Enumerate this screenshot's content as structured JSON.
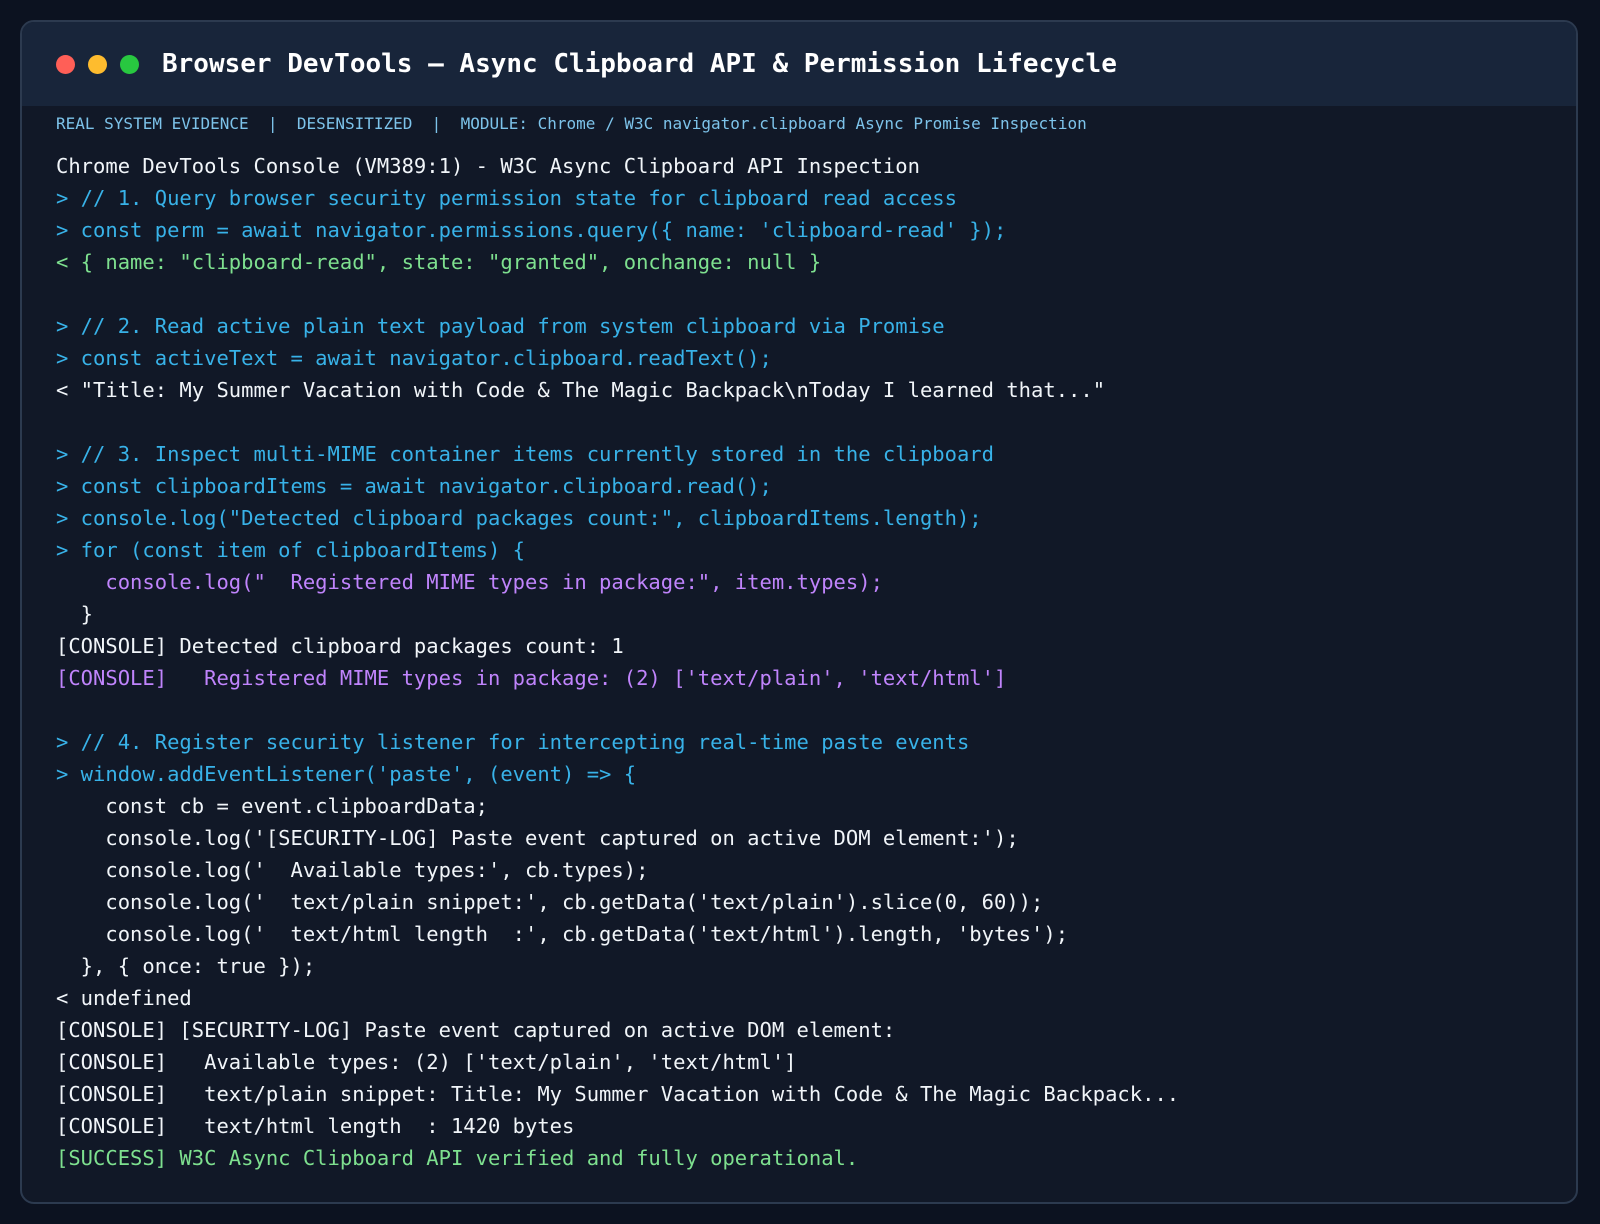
{
  "window": {
    "title": "Browser DevTools — Async Clipboard API & Permission Lifecycle",
    "controls": [
      {
        "name": "close-dot",
        "color": "#ff5f57"
      },
      {
        "name": "minimize-dot",
        "color": "#febc2e"
      },
      {
        "name": "maximize-dot",
        "color": "#28c840"
      }
    ]
  },
  "meta_banner": "REAL SYSTEM EVIDENCE  |  DESENSITIZED  |  MODULE: Chrome / W3C navigator.clipboard Async Promise Inspection",
  "console": {
    "lines": [
      {
        "kind": "header",
        "text": "Chrome DevTools Console (VM389:1) - W3C Async Clipboard API Inspection"
      },
      {
        "kind": "input",
        "text": "> // 1. Query browser security permission state for clipboard read access"
      },
      {
        "kind": "input",
        "text": "> const perm = await navigator.permissions.query({ name: 'clipboard-read' });"
      },
      {
        "kind": "result-obj",
        "text": "< { name: \"clipboard-read\", state: \"granted\", onchange: null }"
      },
      {
        "kind": "blank",
        "text": ""
      },
      {
        "kind": "input",
        "text": "> // 2. Read active plain text payload from system clipboard via Promise"
      },
      {
        "kind": "input",
        "text": "> const activeText = await navigator.clipboard.readText();"
      },
      {
        "kind": "plain",
        "text": "< \"Title: My Summer Vacation with Code & The Magic Backpack\\nToday I learned that...\""
      },
      {
        "kind": "blank",
        "text": ""
      },
      {
        "kind": "input",
        "text": "> // 3. Inspect multi-MIME container items currently stored in the clipboard"
      },
      {
        "kind": "input",
        "text": "> const clipboardItems = await navigator.clipboard.read();"
      },
      {
        "kind": "input",
        "text": "> console.log(\"Detected clipboard packages count:\", clipboardItems.length);"
      },
      {
        "kind": "input",
        "text": "> for (const item of clipboardItems) {"
      },
      {
        "kind": "purple",
        "text": "    console.log(\"  Registered MIME types in package:\", item.types);"
      },
      {
        "kind": "plain",
        "text": "  }"
      },
      {
        "kind": "plain",
        "text": "[CONSOLE] Detected clipboard packages count: 1"
      },
      {
        "kind": "purple",
        "text": "[CONSOLE]   Registered MIME types in package: (2) ['text/plain', 'text/html']"
      },
      {
        "kind": "blank",
        "text": ""
      },
      {
        "kind": "input",
        "text": "> // 4. Register security listener for intercepting real-time paste events"
      },
      {
        "kind": "input",
        "text": "> window.addEventListener('paste', (event) => {"
      },
      {
        "kind": "plain",
        "text": "    const cb = event.clipboardData;"
      },
      {
        "kind": "plain",
        "text": "    console.log('[SECURITY-LOG] Paste event captured on active DOM element:');"
      },
      {
        "kind": "plain",
        "text": "    console.log('  Available types:', cb.types);"
      },
      {
        "kind": "plain",
        "text": "    console.log('  text/plain snippet:', cb.getData('text/plain').slice(0, 60));"
      },
      {
        "kind": "plain",
        "text": "    console.log('  text/html length  :', cb.getData('text/html').length, 'bytes');"
      },
      {
        "kind": "plain",
        "text": "  }, { once: true });"
      },
      {
        "kind": "plain",
        "text": "< undefined"
      },
      {
        "kind": "plain",
        "text": "[CONSOLE] [SECURITY-LOG] Paste event captured on active DOM element:"
      },
      {
        "kind": "plain",
        "text": "[CONSOLE]   Available types: (2) ['text/plain', 'text/html']"
      },
      {
        "kind": "plain",
        "text": "[CONSOLE]   text/plain snippet: Title: My Summer Vacation with Code & The Magic Backpack..."
      },
      {
        "kind": "plain",
        "text": "[CONSOLE]   text/html length  : 1420 bytes"
      },
      {
        "kind": "success",
        "text": "[SUCCESS] W3C Async Clipboard API verified and fully operational."
      }
    ]
  }
}
